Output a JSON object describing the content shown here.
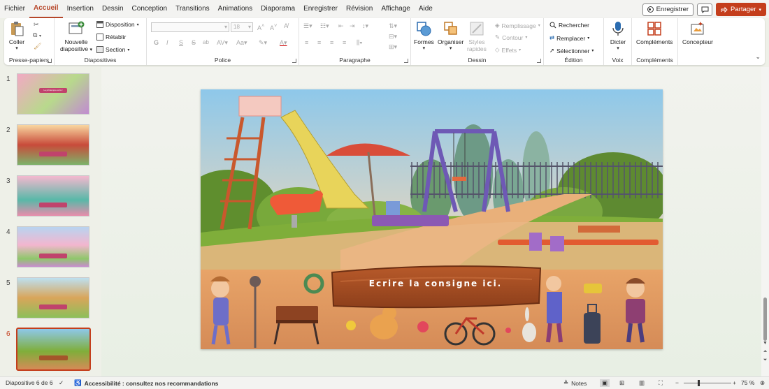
{
  "menu": {
    "tabs": [
      "Fichier",
      "Accueil",
      "Insertion",
      "Dessin",
      "Conception",
      "Transitions",
      "Animations",
      "Diaporama",
      "Enregistrer",
      "Révision",
      "Affichage",
      "Aide"
    ],
    "active": "Accueil",
    "record_label": "Enregistrer",
    "share_label": "Partager"
  },
  "ribbon": {
    "clipboard": {
      "paste": "Coller",
      "label": "Presse-papiers"
    },
    "slides": {
      "new_slide_l1": "Nouvelle",
      "new_slide_l2": "diapositive",
      "layout": "Disposition",
      "reset": "Rétablir",
      "section": "Section",
      "label": "Diapositives"
    },
    "font": {
      "size": "18",
      "label": "Police",
      "bold": "G",
      "italic": "I",
      "underline": "S",
      "strike": "S",
      "shadow": "ab",
      "case": "Aa"
    },
    "paragraph": {
      "label": "Paragraphe"
    },
    "drawing": {
      "shapes": "Formes",
      "arrange": "Organiser",
      "styles_l1": "Styles",
      "styles_l2": "rapides",
      "fill": "Remplissage",
      "outline": "Contour",
      "effects": "Effets",
      "label": "Dessin"
    },
    "editing": {
      "find": "Rechercher",
      "replace": "Remplacer",
      "select": "Sélectionner",
      "label": "Édition"
    },
    "voice": {
      "dictate": "Dicter",
      "label": "Voix"
    },
    "addins": {
      "addins": "Compléments",
      "label": "Compléments"
    },
    "designer": {
      "label": "Concepteur"
    }
  },
  "thumbnails": [
    {
      "num": "1",
      "band_text": "Le printemps est là !"
    },
    {
      "num": "2",
      "band_text": ""
    },
    {
      "num": "3",
      "band_text": ""
    },
    {
      "num": "4",
      "band_text": ""
    },
    {
      "num": "5",
      "band_text": ""
    },
    {
      "num": "6",
      "band_text": ""
    }
  ],
  "selected_slide": 6,
  "slide": {
    "instruction": "Ecrire la consigne ici."
  },
  "status": {
    "slide_info": "Diapositive 6 de 6",
    "accessibility": "Accessibilité : consultez nos recommandations",
    "notes": "Notes",
    "zoom": "75 %"
  },
  "colors": {
    "accent": "#c43e1c",
    "active_tab": "#b7472a"
  }
}
